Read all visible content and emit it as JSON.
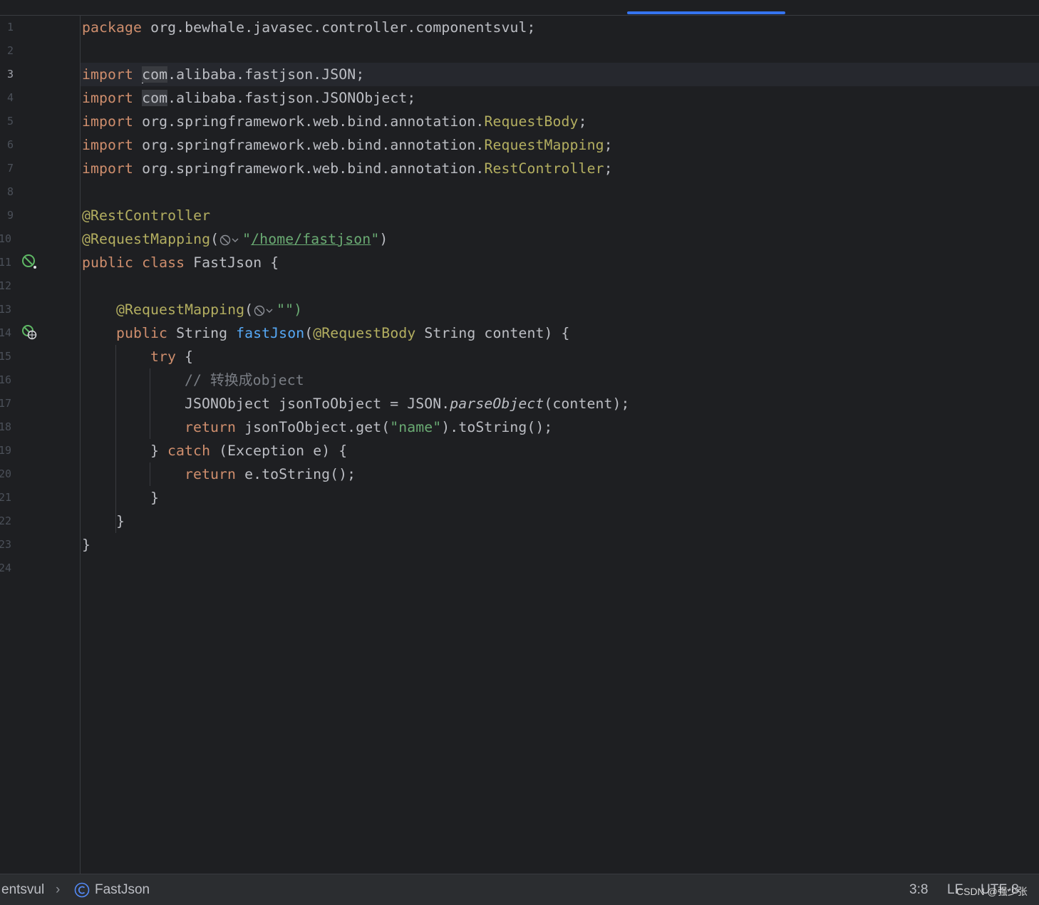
{
  "editor": {
    "line_numbers": [
      "1",
      "2",
      "3",
      "4",
      "5",
      "6",
      "7",
      "8",
      "9",
      "10",
      "11",
      "12",
      "13",
      "14",
      "15",
      "16",
      "17",
      "18",
      "19",
      "20",
      "21",
      "22",
      "23",
      "24"
    ],
    "current_line": "3",
    "tokens": {
      "package_kw": "package",
      "package_name": " org.bewhale.javasec.controller.componentsvul;",
      "import_kw": "import",
      "com": "com",
      "import1_rest": ".alibaba.fastjson.JSON;",
      "import2_rest": ".alibaba.fastjson.JSONObject;",
      "spring_pkg": " org.springframework.web.bind.annotation.",
      "request_body": "RequestBody",
      "request_mapping": "RequestMapping",
      "rest_controller": "RestController",
      "semicolon": ";",
      "anno_rest_controller": "@RestController",
      "anno_request_mapping": "@RequestMapping",
      "paren_open": "(",
      "quote": "\"",
      "path": "/home/fastjson",
      "quote_paren_close": "\")",
      "empty_string_close": "\"\")",
      "public_kw": "public",
      "class_kw": "class",
      "class_name": " FastJson {",
      "string_type": " String ",
      "method_name": "fastJson",
      "anno_request_body": "@RequestBody",
      "params_rest": " String content) {",
      "try_kw": "try",
      "open_brace": " {",
      "comment": "// 转换成object",
      "json_object_decl": "JSONObject jsonToObject = JSON.",
      "parse_object": "parseObject",
      "parse_args": "(content);",
      "return_kw": "return",
      "get_call": " jsonToObject.get(",
      "name_str": "\"name\"",
      "to_string_end": ").toString();",
      "close_brace_catch": "} ",
      "catch_kw": "catch",
      "catch_args": " (Exception e) {",
      "e_to_string": " e.toString();",
      "close_brace": "}"
    }
  },
  "status_bar": {
    "breadcrumb_package": "entsvul",
    "breadcrumb_separator": "›",
    "breadcrumb_class": "FastJson",
    "cursor_position": "3:8",
    "line_separator": "LF",
    "encoding": "UTF-8"
  },
  "watermark": "CSDN @强少张",
  "colors": {
    "background": "#1e1f22",
    "keyword": "#cf8e6d",
    "annotation": "#b3ae60",
    "string": "#6aab73",
    "function": "#56a8f5",
    "comment": "#7a7e85",
    "text": "#bcbec4",
    "accent": "#3574f0"
  },
  "icons": {
    "class_gutter": "spring-bean-icon",
    "method_gutter": "web-endpoint-icon",
    "inlay": "globe-dropdown-icon",
    "breadcrumb": "class-c-icon"
  }
}
